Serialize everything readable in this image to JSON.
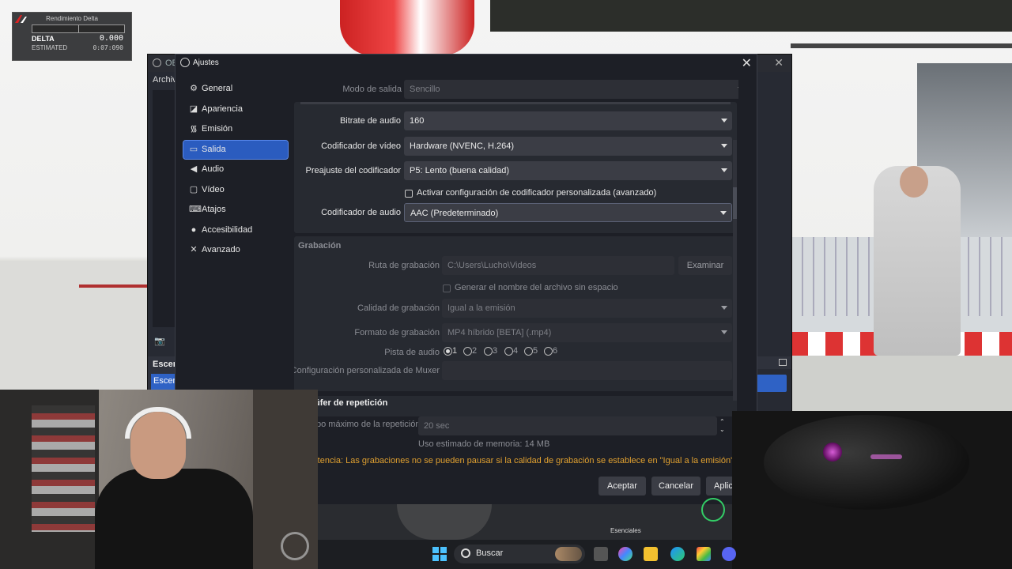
{
  "overlay": {
    "title": "Rendimiento Delta",
    "delta_label": "DELTA",
    "delta_value": "0.000",
    "estimated_label": "ESTIMATED",
    "estimated_value": "0:07:090"
  },
  "obs_main": {
    "title": "OB",
    "menu_file": "Archiv",
    "scenes_header": "Escen",
    "scene_selected": "Escen"
  },
  "dialog": {
    "title": "Ajustes",
    "nav": [
      {
        "label": "General",
        "icon": "gear-icon"
      },
      {
        "label": "Apariencia",
        "icon": "palette-icon"
      },
      {
        "label": "Emisión",
        "icon": "antenna-icon"
      },
      {
        "label": "Salida",
        "icon": "output-icon"
      },
      {
        "label": "Audio",
        "icon": "speaker-icon"
      },
      {
        "label": "Vídeo",
        "icon": "monitor-icon"
      },
      {
        "label": "Atajos",
        "icon": "keyboard-icon"
      },
      {
        "label": "Accesibilidad",
        "icon": "accessibility-icon"
      },
      {
        "label": "Avanzado",
        "icon": "wrench-icon"
      }
    ],
    "active_nav": "Salida",
    "output_mode": {
      "label": "Modo de salida",
      "value": "Sencillo"
    },
    "streaming": {
      "audio_bitrate": {
        "label": "Bitrate de audio",
        "value": "160"
      },
      "video_encoder": {
        "label": "Codificador de vídeo",
        "value": "Hardware (NVENC, H.264)"
      },
      "encoder_preset": {
        "label": "Preajuste del codificador",
        "value": "P5: Lento (buena calidad)"
      },
      "custom_encoder_checkbox": "Activar configuración de codificador personalizada (avanzado)",
      "audio_encoder": {
        "label": "Codificador de audio",
        "value": "AAC (Predeterminado)"
      }
    },
    "recording": {
      "header": "Grabación",
      "path": {
        "label": "Ruta de grabación",
        "value": "C:\\Users\\Lucho\\Videos",
        "browse": "Examinar"
      },
      "no_space_checkbox": "Generar el nombre del archivo sin espacio",
      "quality": {
        "label": "Calidad de grabación",
        "value": "Igual a la emisión"
      },
      "format": {
        "label": "Formato de grabación",
        "value": "MP4 híbrido [BETA] (.mp4)"
      },
      "audio_track": {
        "label": "Pista de audio",
        "tracks": [
          "1",
          "2",
          "3",
          "4",
          "5",
          "6"
        ],
        "selected": "1"
      },
      "muxer": {
        "label": "Configuración personalizada de Muxer",
        "value": ""
      }
    },
    "replay": {
      "header": "úfer de repetición",
      "max_time": {
        "label": "po máximo de la repetición",
        "value": "20 sec"
      },
      "memory": "Uso estimado de memoria: 14 MB"
    },
    "warning": "rtencia: Las grabaciones no se pueden pausar si la calidad de grabación se establece en \"Igual a la emisión\".",
    "buttons": {
      "accept": "Aceptar",
      "cancel": "Cancelar",
      "apply": "Aplic"
    }
  },
  "taskbar": {
    "search_placeholder": "Buscar",
    "strip_label": "Esenciales"
  },
  "colors": {
    "accent": "#2b5cbf",
    "warning": "#e0a030",
    "dialog_bg": "#1d1f26",
    "group_bg": "#272a31"
  }
}
